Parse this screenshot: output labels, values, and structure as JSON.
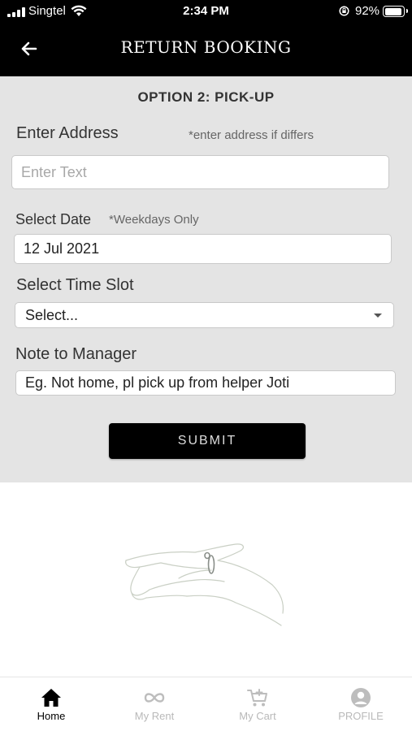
{
  "status_bar": {
    "carrier": "Singtel",
    "time": "2:34 PM",
    "battery_percent": "92%",
    "battery_level": 0.92
  },
  "header": {
    "title": "RETURN BOOKING",
    "back_icon": "arrow-left-icon"
  },
  "form": {
    "section_title": "OPTION 2: PICK-UP",
    "address": {
      "label": "Enter Address",
      "hint": "*enter address if differs",
      "placeholder": "Enter Text"
    },
    "date": {
      "label": "Select Date",
      "hint": "*Weekdays Only",
      "value": "12 Jul 2021"
    },
    "time_slot": {
      "label": "Select Time Slot",
      "value": "Select..."
    },
    "note": {
      "label": "Note to Manager",
      "value": "Eg. Not home, pl pick up from helper Joti"
    },
    "submit_label": "SUBMIT"
  },
  "tabs": [
    {
      "label": "Home",
      "icon": "home-icon",
      "active": true
    },
    {
      "label": "My Rent",
      "icon": "infinity-icon",
      "active": false
    },
    {
      "label": "My Cart",
      "icon": "cart-icon",
      "active": false
    },
    {
      "label": "PROFILE",
      "icon": "profile-icon",
      "active": false
    }
  ],
  "colors": {
    "header_bg": "#000000",
    "panel_bg": "#e4e4e4",
    "active_tab": "#000000",
    "inactive_tab": "#b9b9b9"
  }
}
